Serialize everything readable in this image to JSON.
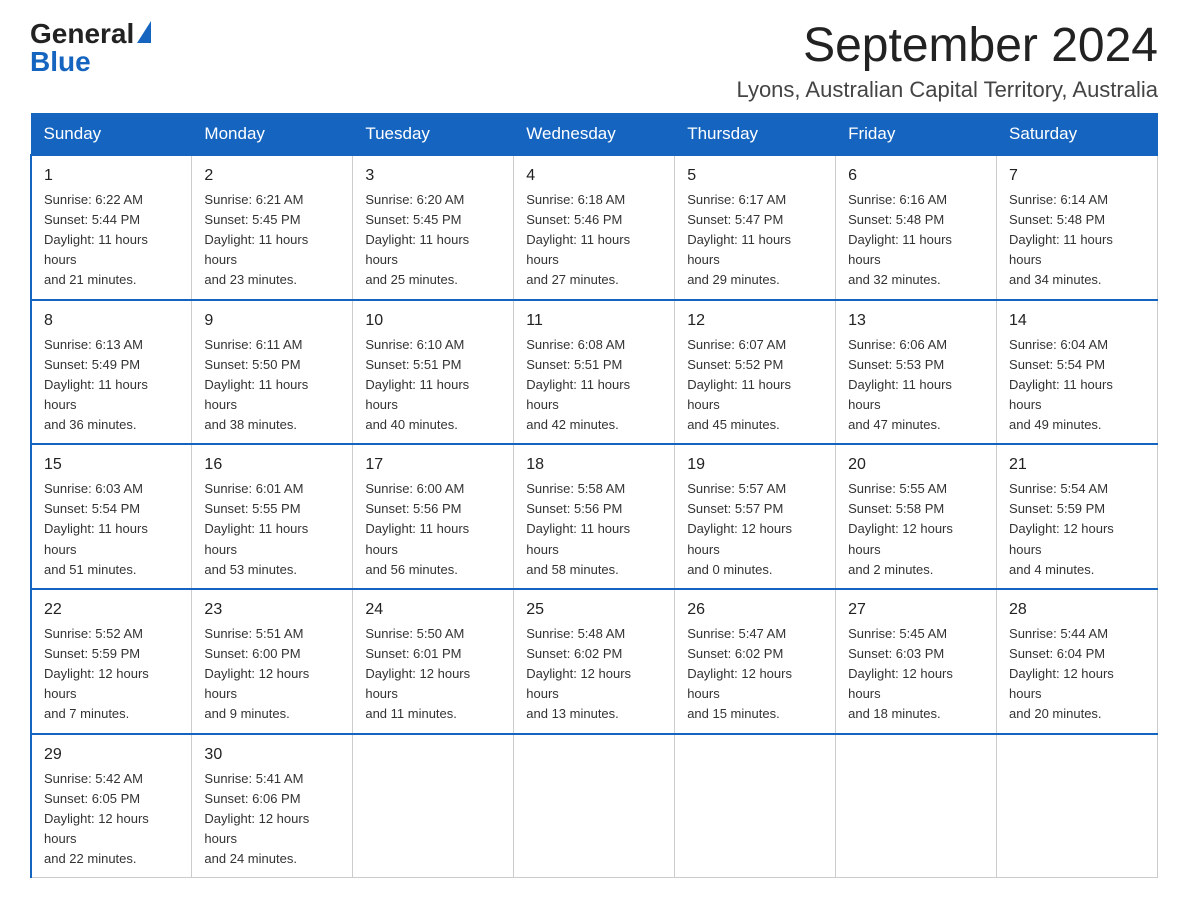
{
  "header": {
    "logo_general": "General",
    "logo_blue": "Blue",
    "title": "September 2024",
    "subtitle": "Lyons, Australian Capital Territory, Australia"
  },
  "days_of_week": [
    "Sunday",
    "Monday",
    "Tuesday",
    "Wednesday",
    "Thursday",
    "Friday",
    "Saturday"
  ],
  "weeks": [
    [
      {
        "day": "1",
        "sunrise": "6:22 AM",
        "sunset": "5:44 PM",
        "daylight": "11 hours and 21 minutes."
      },
      {
        "day": "2",
        "sunrise": "6:21 AM",
        "sunset": "5:45 PM",
        "daylight": "11 hours and 23 minutes."
      },
      {
        "day": "3",
        "sunrise": "6:20 AM",
        "sunset": "5:45 PM",
        "daylight": "11 hours and 25 minutes."
      },
      {
        "day": "4",
        "sunrise": "6:18 AM",
        "sunset": "5:46 PM",
        "daylight": "11 hours and 27 minutes."
      },
      {
        "day": "5",
        "sunrise": "6:17 AM",
        "sunset": "5:47 PM",
        "daylight": "11 hours and 29 minutes."
      },
      {
        "day": "6",
        "sunrise": "6:16 AM",
        "sunset": "5:48 PM",
        "daylight": "11 hours and 32 minutes."
      },
      {
        "day": "7",
        "sunrise": "6:14 AM",
        "sunset": "5:48 PM",
        "daylight": "11 hours and 34 minutes."
      }
    ],
    [
      {
        "day": "8",
        "sunrise": "6:13 AM",
        "sunset": "5:49 PM",
        "daylight": "11 hours and 36 minutes."
      },
      {
        "day": "9",
        "sunrise": "6:11 AM",
        "sunset": "5:50 PM",
        "daylight": "11 hours and 38 minutes."
      },
      {
        "day": "10",
        "sunrise": "6:10 AM",
        "sunset": "5:51 PM",
        "daylight": "11 hours and 40 minutes."
      },
      {
        "day": "11",
        "sunrise": "6:08 AM",
        "sunset": "5:51 PM",
        "daylight": "11 hours and 42 minutes."
      },
      {
        "day": "12",
        "sunrise": "6:07 AM",
        "sunset": "5:52 PM",
        "daylight": "11 hours and 45 minutes."
      },
      {
        "day": "13",
        "sunrise": "6:06 AM",
        "sunset": "5:53 PM",
        "daylight": "11 hours and 47 minutes."
      },
      {
        "day": "14",
        "sunrise": "6:04 AM",
        "sunset": "5:54 PM",
        "daylight": "11 hours and 49 minutes."
      }
    ],
    [
      {
        "day": "15",
        "sunrise": "6:03 AM",
        "sunset": "5:54 PM",
        "daylight": "11 hours and 51 minutes."
      },
      {
        "day": "16",
        "sunrise": "6:01 AM",
        "sunset": "5:55 PM",
        "daylight": "11 hours and 53 minutes."
      },
      {
        "day": "17",
        "sunrise": "6:00 AM",
        "sunset": "5:56 PM",
        "daylight": "11 hours and 56 minutes."
      },
      {
        "day": "18",
        "sunrise": "5:58 AM",
        "sunset": "5:56 PM",
        "daylight": "11 hours and 58 minutes."
      },
      {
        "day": "19",
        "sunrise": "5:57 AM",
        "sunset": "5:57 PM",
        "daylight": "12 hours and 0 minutes."
      },
      {
        "day": "20",
        "sunrise": "5:55 AM",
        "sunset": "5:58 PM",
        "daylight": "12 hours and 2 minutes."
      },
      {
        "day": "21",
        "sunrise": "5:54 AM",
        "sunset": "5:59 PM",
        "daylight": "12 hours and 4 minutes."
      }
    ],
    [
      {
        "day": "22",
        "sunrise": "5:52 AM",
        "sunset": "5:59 PM",
        "daylight": "12 hours and 7 minutes."
      },
      {
        "day": "23",
        "sunrise": "5:51 AM",
        "sunset": "6:00 PM",
        "daylight": "12 hours and 9 minutes."
      },
      {
        "day": "24",
        "sunrise": "5:50 AM",
        "sunset": "6:01 PM",
        "daylight": "12 hours and 11 minutes."
      },
      {
        "day": "25",
        "sunrise": "5:48 AM",
        "sunset": "6:02 PM",
        "daylight": "12 hours and 13 minutes."
      },
      {
        "day": "26",
        "sunrise": "5:47 AM",
        "sunset": "6:02 PM",
        "daylight": "12 hours and 15 minutes."
      },
      {
        "day": "27",
        "sunrise": "5:45 AM",
        "sunset": "6:03 PM",
        "daylight": "12 hours and 18 minutes."
      },
      {
        "day": "28",
        "sunrise": "5:44 AM",
        "sunset": "6:04 PM",
        "daylight": "12 hours and 20 minutes."
      }
    ],
    [
      {
        "day": "29",
        "sunrise": "5:42 AM",
        "sunset": "6:05 PM",
        "daylight": "12 hours and 22 minutes."
      },
      {
        "day": "30",
        "sunrise": "5:41 AM",
        "sunset": "6:06 PM",
        "daylight": "12 hours and 24 minutes."
      },
      null,
      null,
      null,
      null,
      null
    ]
  ],
  "labels": {
    "sunrise": "Sunrise: ",
    "sunset": "Sunset: ",
    "daylight": "Daylight: "
  }
}
